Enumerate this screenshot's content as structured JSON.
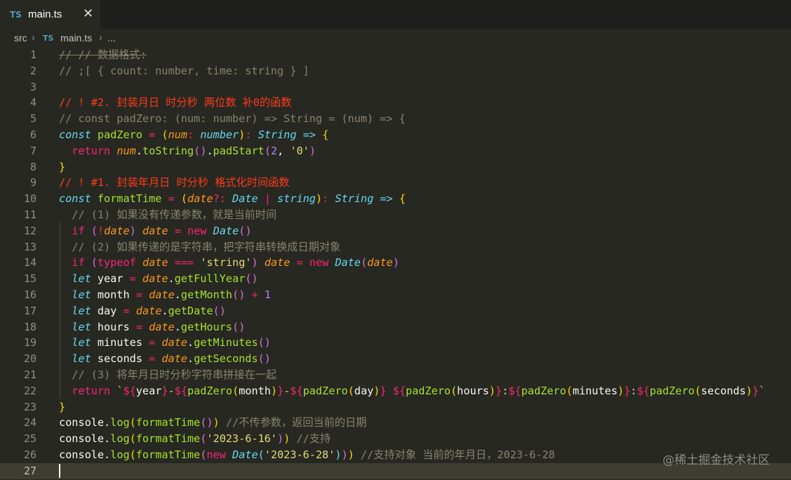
{
  "tab": {
    "badge": "TS",
    "name": "main.ts",
    "close": "✕"
  },
  "breadcrumb": {
    "folder": "src",
    "badge": "TS",
    "file": "main.ts",
    "rest": "..."
  },
  "colors": {
    "background": "#272822",
    "comment": "#88846f",
    "keyword": "#f92672",
    "storage": "#66d9ef",
    "function": "#a6e22e",
    "string": "#e6db74",
    "number": "#ae81ff",
    "parameter": "#fd971f",
    "plain": "#f8f8f2",
    "red_comment": "#ff3a1a",
    "brace": "#ffd700",
    "bracket2": "#da70d6"
  },
  "lines": [
    {
      "n": "1",
      "t": [
        [
          "// // 数据格式:",
          "cs"
        ]
      ]
    },
    {
      "n": "2",
      "t": [
        [
          "// ;[ { count: number, time: string } ]",
          "c"
        ]
      ]
    },
    {
      "n": "3",
      "t": []
    },
    {
      "n": "4",
      "t": [
        [
          "// ! #2. 封装月日 时分秒 两位数 补0的函数",
          "r"
        ]
      ]
    },
    {
      "n": "5",
      "t": [
        [
          "// const padZero: (num: number) => String = (num) => {",
          "c"
        ]
      ]
    },
    {
      "n": "6",
      "t": [
        [
          "const",
          "sti"
        ],
        [
          " ",
          "p"
        ],
        [
          "padZero",
          "fn"
        ],
        [
          " ",
          "p"
        ],
        [
          "=",
          "k"
        ],
        [
          " ",
          "p"
        ],
        [
          "(",
          "b1"
        ],
        [
          "num",
          "par"
        ],
        [
          ":",
          "k"
        ],
        [
          " ",
          "p"
        ],
        [
          "number",
          "sti"
        ],
        [
          ")",
          "b1"
        ],
        [
          ":",
          "k"
        ],
        [
          " ",
          "p"
        ],
        [
          "String",
          "sti"
        ],
        [
          " ",
          "p"
        ],
        [
          "=>",
          "sti"
        ],
        [
          " ",
          "p"
        ],
        [
          "{",
          "b1"
        ]
      ]
    },
    {
      "n": "7",
      "t": [
        [
          "  ",
          "p"
        ],
        [
          "return",
          "k"
        ],
        [
          " ",
          "p"
        ],
        [
          "num",
          "pari"
        ],
        [
          ".",
          "p"
        ],
        [
          "toString",
          "fn"
        ],
        [
          "(",
          "b2"
        ],
        [
          ")",
          "b2"
        ],
        [
          ".",
          "p"
        ],
        [
          "padStart",
          "fn"
        ],
        [
          "(",
          "b2"
        ],
        [
          "2",
          "num"
        ],
        [
          ", ",
          "p"
        ],
        [
          "'0'",
          "s"
        ],
        [
          ")",
          "b2"
        ]
      ]
    },
    {
      "n": "8",
      "t": [
        [
          "}",
          "b1"
        ]
      ]
    },
    {
      "n": "9",
      "t": [
        [
          "// ! #1. 封装年月日 时分秒 格式化时间函数",
          "r"
        ]
      ]
    },
    {
      "n": "10",
      "t": [
        [
          "const",
          "sti"
        ],
        [
          " ",
          "p"
        ],
        [
          "formatTime",
          "fn"
        ],
        [
          " ",
          "p"
        ],
        [
          "=",
          "k"
        ],
        [
          " ",
          "p"
        ],
        [
          "(",
          "b1"
        ],
        [
          "date",
          "pari"
        ],
        [
          "?:",
          "k"
        ],
        [
          " ",
          "p"
        ],
        [
          "Date",
          "sti"
        ],
        [
          " ",
          "p"
        ],
        [
          "|",
          "k"
        ],
        [
          " ",
          "p"
        ],
        [
          "string",
          "sti"
        ],
        [
          ")",
          "b1"
        ],
        [
          ":",
          "k"
        ],
        [
          " ",
          "p"
        ],
        [
          "String",
          "sti"
        ],
        [
          " ",
          "p"
        ],
        [
          "=>",
          "sti"
        ],
        [
          " ",
          "p"
        ],
        [
          "{",
          "b1"
        ]
      ]
    },
    {
      "n": "11",
      "t": [
        [
          "  // (1) 如果没有传递参数，就是当前时间",
          "c"
        ]
      ]
    },
    {
      "n": "12",
      "t": [
        [
          "  ",
          "p"
        ],
        [
          "if",
          "k"
        ],
        [
          " ",
          "p"
        ],
        [
          "(",
          "b2"
        ],
        [
          "!",
          "k"
        ],
        [
          "date",
          "pari"
        ],
        [
          ")",
          "b2"
        ],
        [
          " ",
          "p"
        ],
        [
          "date",
          "pari"
        ],
        [
          " ",
          "p"
        ],
        [
          "=",
          "k"
        ],
        [
          " ",
          "p"
        ],
        [
          "new",
          "k"
        ],
        [
          " ",
          "p"
        ],
        [
          "Date",
          "sti"
        ],
        [
          "(",
          "b2"
        ],
        [
          ")",
          "b2"
        ]
      ]
    },
    {
      "n": "13",
      "t": [
        [
          "  // (2) 如果传递的是字符串，把字符串转换成日期对象",
          "c"
        ]
      ]
    },
    {
      "n": "14",
      "t": [
        [
          "  ",
          "p"
        ],
        [
          "if",
          "k"
        ],
        [
          " ",
          "p"
        ],
        [
          "(",
          "b2"
        ],
        [
          "typeof",
          "k"
        ],
        [
          " ",
          "p"
        ],
        [
          "date",
          "pari"
        ],
        [
          " ",
          "p"
        ],
        [
          "===",
          "k"
        ],
        [
          " ",
          "p"
        ],
        [
          "'string'",
          "s"
        ],
        [
          ")",
          "b2"
        ],
        [
          " ",
          "p"
        ],
        [
          "date",
          "pari"
        ],
        [
          " ",
          "p"
        ],
        [
          "=",
          "k"
        ],
        [
          " ",
          "p"
        ],
        [
          "new",
          "k"
        ],
        [
          " ",
          "p"
        ],
        [
          "Date",
          "sti"
        ],
        [
          "(",
          "b2"
        ],
        [
          "date",
          "pari"
        ],
        [
          ")",
          "b2"
        ]
      ]
    },
    {
      "n": "15",
      "t": [
        [
          "  ",
          "p"
        ],
        [
          "let",
          "sti"
        ],
        [
          " year ",
          "p"
        ],
        [
          "=",
          "k"
        ],
        [
          " ",
          "p"
        ],
        [
          "date",
          "pari"
        ],
        [
          ".",
          "p"
        ],
        [
          "getFullYear",
          "fn"
        ],
        [
          "(",
          "b2"
        ],
        [
          ")",
          "b2"
        ]
      ]
    },
    {
      "n": "16",
      "t": [
        [
          "  ",
          "p"
        ],
        [
          "let",
          "sti"
        ],
        [
          " month ",
          "p"
        ],
        [
          "=",
          "k"
        ],
        [
          " ",
          "p"
        ],
        [
          "date",
          "pari"
        ],
        [
          ".",
          "p"
        ],
        [
          "getMonth",
          "fn"
        ],
        [
          "(",
          "b2"
        ],
        [
          ")",
          "b2"
        ],
        [
          " ",
          "p"
        ],
        [
          "+",
          "k"
        ],
        [
          " ",
          "p"
        ],
        [
          "1",
          "num"
        ]
      ]
    },
    {
      "n": "17",
      "t": [
        [
          "  ",
          "p"
        ],
        [
          "let",
          "sti"
        ],
        [
          " day ",
          "p"
        ],
        [
          "=",
          "k"
        ],
        [
          " ",
          "p"
        ],
        [
          "date",
          "pari"
        ],
        [
          ".",
          "p"
        ],
        [
          "getDate",
          "fn"
        ],
        [
          "(",
          "b2"
        ],
        [
          ")",
          "b2"
        ]
      ]
    },
    {
      "n": "18",
      "t": [
        [
          "  ",
          "p"
        ],
        [
          "let",
          "sti"
        ],
        [
          " hours ",
          "p"
        ],
        [
          "=",
          "k"
        ],
        [
          " ",
          "p"
        ],
        [
          "date",
          "pari"
        ],
        [
          ".",
          "p"
        ],
        [
          "getHours",
          "fn"
        ],
        [
          "(",
          "b2"
        ],
        [
          ")",
          "b2"
        ]
      ]
    },
    {
      "n": "19",
      "t": [
        [
          "  ",
          "p"
        ],
        [
          "let",
          "sti"
        ],
        [
          " minutes ",
          "p"
        ],
        [
          "=",
          "k"
        ],
        [
          " ",
          "p"
        ],
        [
          "date",
          "pari"
        ],
        [
          ".",
          "p"
        ],
        [
          "getMinutes",
          "fn"
        ],
        [
          "(",
          "b2"
        ],
        [
          ")",
          "b2"
        ]
      ]
    },
    {
      "n": "20",
      "t": [
        [
          "  ",
          "p"
        ],
        [
          "let",
          "sti"
        ],
        [
          " seconds ",
          "p"
        ],
        [
          "=",
          "k"
        ],
        [
          " ",
          "p"
        ],
        [
          "date",
          "pari"
        ],
        [
          ".",
          "p"
        ],
        [
          "getSeconds",
          "fn"
        ],
        [
          "(",
          "b2"
        ],
        [
          ")",
          "b2"
        ]
      ]
    },
    {
      "n": "21",
      "t": [
        [
          "  // (3) 将年月日时分秒字符串拼接在一起",
          "c"
        ]
      ]
    },
    {
      "n": "22",
      "t": [
        [
          "  ",
          "p"
        ],
        [
          "return",
          "k"
        ],
        [
          " ",
          "p"
        ],
        [
          "`",
          "s"
        ],
        [
          "${",
          "k"
        ],
        [
          "year",
          "p"
        ],
        [
          "}",
          "k"
        ],
        [
          "-",
          "s"
        ],
        [
          "${",
          "k"
        ],
        [
          "padZero",
          "fn"
        ],
        [
          "(",
          "b1"
        ],
        [
          "month",
          "p"
        ],
        [
          ")",
          "b1"
        ],
        [
          "}",
          "k"
        ],
        [
          "-",
          "s"
        ],
        [
          "${",
          "k"
        ],
        [
          "padZero",
          "fn"
        ],
        [
          "(",
          "b1"
        ],
        [
          "day",
          "p"
        ],
        [
          ")",
          "b1"
        ],
        [
          "}",
          "k"
        ],
        [
          " ",
          "s"
        ],
        [
          "${",
          "k"
        ],
        [
          "padZero",
          "fn"
        ],
        [
          "(",
          "b1"
        ],
        [
          "hours",
          "p"
        ],
        [
          ")",
          "b1"
        ],
        [
          "}",
          "k"
        ],
        [
          ":",
          "s"
        ],
        [
          "${",
          "k"
        ],
        [
          "padZero",
          "fn"
        ],
        [
          "(",
          "b1"
        ],
        [
          "minutes",
          "p"
        ],
        [
          ")",
          "b1"
        ],
        [
          "}",
          "k"
        ],
        [
          ":",
          "s"
        ],
        [
          "${",
          "k"
        ],
        [
          "padZero",
          "fn"
        ],
        [
          "(",
          "b1"
        ],
        [
          "seconds",
          "p"
        ],
        [
          ")",
          "b1"
        ],
        [
          "}",
          "k"
        ],
        [
          "`",
          "s"
        ]
      ]
    },
    {
      "n": "23",
      "t": [
        [
          "}",
          "b1"
        ]
      ]
    },
    {
      "n": "24",
      "t": [
        [
          "console",
          "p"
        ],
        [
          ".",
          "p"
        ],
        [
          "log",
          "fn"
        ],
        [
          "(",
          "b1"
        ],
        [
          "formatTime",
          "fn"
        ],
        [
          "(",
          "b2"
        ],
        [
          ")",
          "b2"
        ],
        [
          ")",
          "b1"
        ],
        [
          " //不传参数，返回当前的日期",
          "c"
        ]
      ]
    },
    {
      "n": "25",
      "t": [
        [
          "console",
          "p"
        ],
        [
          ".",
          "p"
        ],
        [
          "log",
          "fn"
        ],
        [
          "(",
          "b1"
        ],
        [
          "formatTime",
          "fn"
        ],
        [
          "(",
          "b2"
        ],
        [
          "'2023-6-16'",
          "s"
        ],
        [
          ")",
          "b2"
        ],
        [
          ")",
          "b1"
        ],
        [
          " //支持",
          "c"
        ]
      ]
    },
    {
      "n": "26",
      "t": [
        [
          "console",
          "p"
        ],
        [
          ".",
          "p"
        ],
        [
          "log",
          "fn"
        ],
        [
          "(",
          "b1"
        ],
        [
          "formatTime",
          "fn"
        ],
        [
          "(",
          "b2"
        ],
        [
          "new",
          "k"
        ],
        [
          " ",
          "p"
        ],
        [
          "Date",
          "sti"
        ],
        [
          "(",
          "b3"
        ],
        [
          "'2023-6-28'",
          "s"
        ],
        [
          ")",
          "b3"
        ],
        [
          ")",
          "b2"
        ],
        [
          ")",
          "b1"
        ],
        [
          " //支持对象 当前的年月日，2023-6-28",
          "c"
        ]
      ]
    },
    {
      "n": "27",
      "t": []
    }
  ],
  "watermark": "@稀土掘金技术社区"
}
